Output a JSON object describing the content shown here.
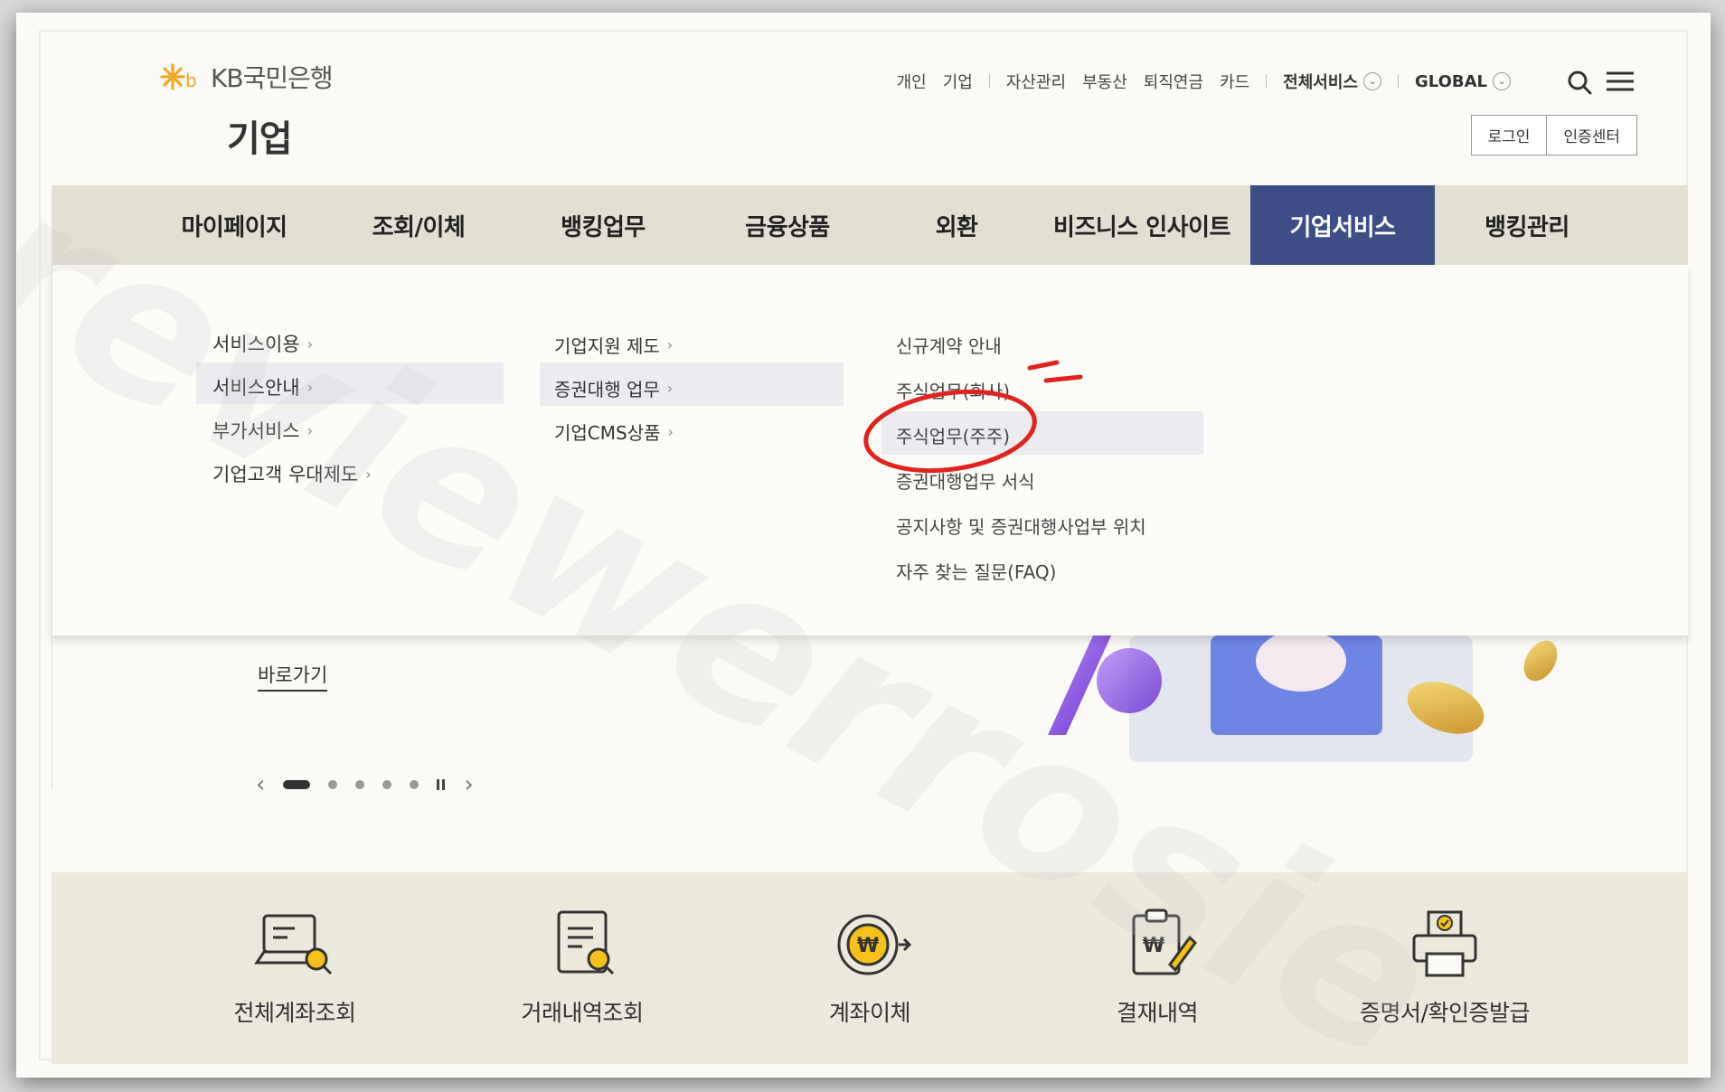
{
  "header": {
    "logo_text": "KB국민은행",
    "section_title": "기업",
    "util_links": [
      "개인",
      "기업",
      "자산관리",
      "부동산",
      "퇴직연금",
      "카드"
    ],
    "all_services": "전체서비스",
    "global": "GLOBAL",
    "login": "로그인",
    "cert_center": "인증센터"
  },
  "gnb": {
    "items": [
      "마이페이지",
      "조회/이체",
      "뱅킹업무",
      "금융상품",
      "외환",
      "비즈니스 인사이트",
      "기업서비스",
      "뱅킹관리"
    ],
    "active_index": 6
  },
  "dropdown": {
    "col1": [
      "서비스이용",
      "서비스안내",
      "부가서비스",
      "기업고객 우대제도"
    ],
    "col2": [
      "기업지원 제도",
      "증권대행 업무",
      "기업CMS상품"
    ],
    "col3": [
      "신규계약 안내",
      "주식업무(회사)",
      "주식업무(주주)",
      "증권대행업무 서식",
      "공지사항 및 증권대행사업부 위치",
      "자주 찾는 질문(FAQ)"
    ]
  },
  "hero": {
    "shortcut": "바로가기",
    "prev": "‹",
    "next": "›"
  },
  "quick_menu": [
    "전체계좌조회",
    "거래내역조회",
    "계좌이체",
    "결재내역",
    "증명서/확인증발급"
  ],
  "watermark": "reviewerrosie",
  "colors": {
    "gnb_bg": "#e3dfd3",
    "gnb_active": "#3c4e85",
    "quick_bg": "#ece9dc",
    "logo_star": "#f5a623",
    "annotation_red": "#e0231c"
  }
}
